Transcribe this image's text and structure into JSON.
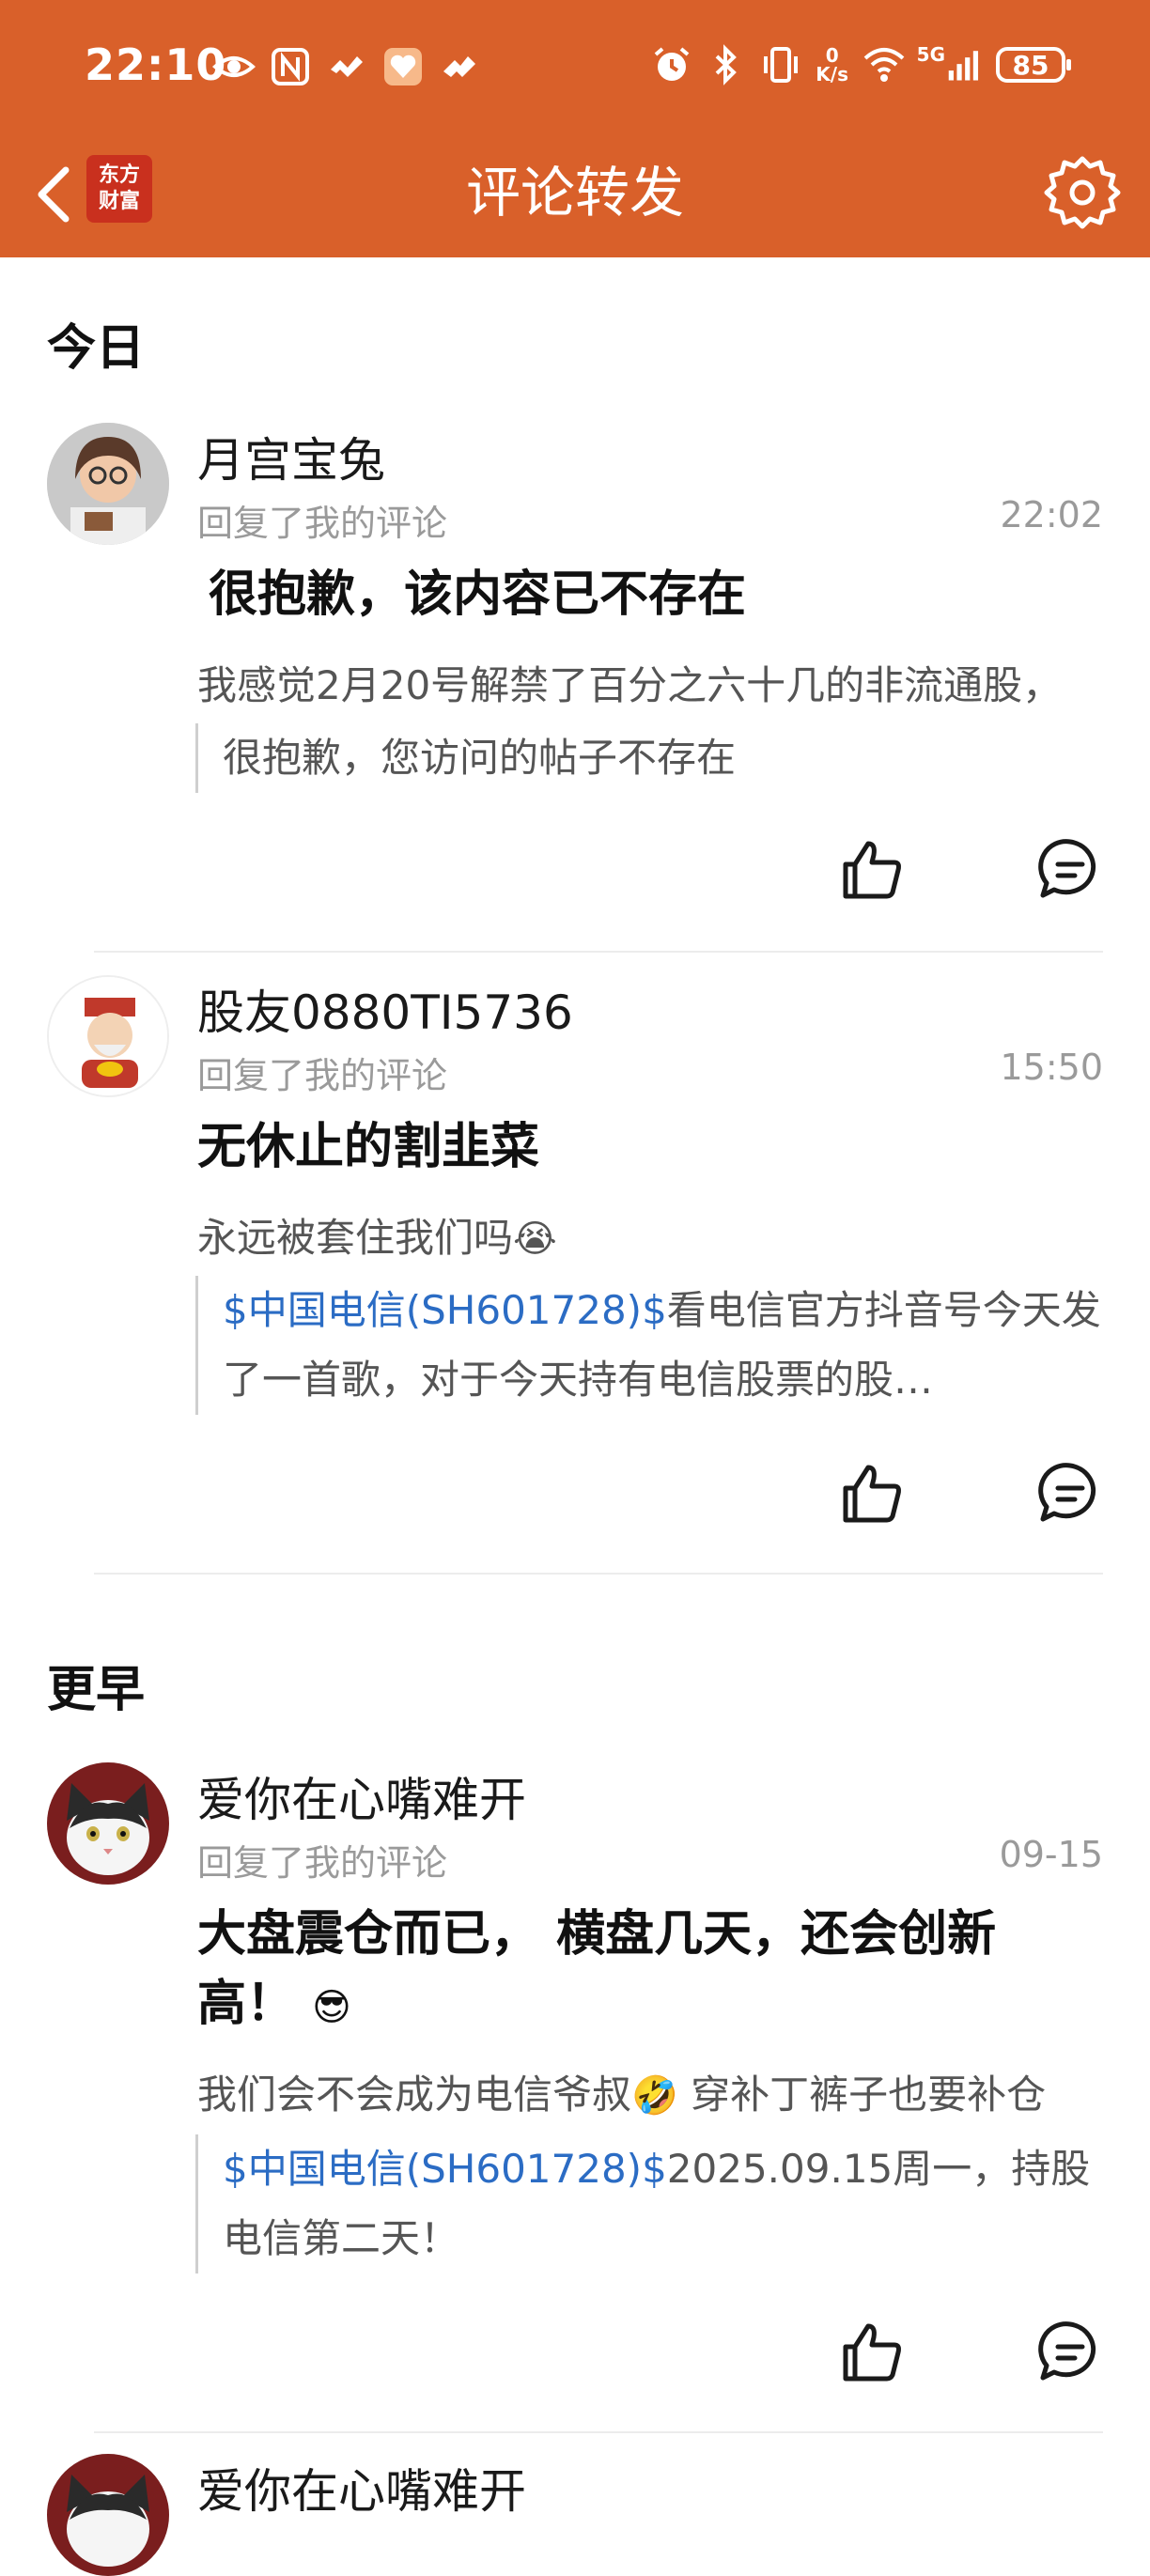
{
  "status_bar": {
    "time": "22:10",
    "net_speed_top": "0",
    "net_speed_unit": "K/s",
    "network": "5G",
    "battery": "85",
    "icons_left": [
      "eye-icon",
      "nfc-icon",
      "app-icon",
      "heart-badge-icon",
      "app-icon-2"
    ],
    "icons_right": [
      "alarm-icon",
      "bluetooth-icon",
      "vibrate-icon",
      "wifi-icon",
      "signal-icon"
    ]
  },
  "nav": {
    "brand_line1": "东方",
    "brand_line2": "财富",
    "title": "评论转发"
  },
  "sections": {
    "today": "今日",
    "earlier": "更早"
  },
  "items": [
    {
      "username": "月宫宝兔",
      "action": "回复了我的评论",
      "time": "22:02",
      "comment": "很抱歉，该内容已不存在",
      "reply": "我感觉2月20号解禁了百分之六十几的非流通股，",
      "quote_link": "",
      "quote_text": "很抱歉，您访问的帖子不存在"
    },
    {
      "username": "股友0880TI5736",
      "action": "回复了我的评论",
      "time": "15:50",
      "comment": "无休止的割韭菜",
      "reply": "永远被套住我们吗",
      "reply_emoji": "😭",
      "quote_link": "$中国电信(SH601728)$",
      "quote_text": "看电信官方抖音号今天发了一首歌，对于今天持有电信股票的股…"
    },
    {
      "username": "爱你在心嘴难开",
      "action": "回复了我的评论",
      "time": "09-15",
      "comment": "大盘震仓而已， 横盘几天，还会创新高！",
      "comment_emoji": "😎",
      "reply": "我们会不会成为电信爷叔",
      "reply_emoji": "🤣",
      "reply_tail": "  穿补丁裤子也要补仓",
      "quote_link": "$中国电信(SH601728)$",
      "quote_text": "2025.09.15周一，持股电信第二天！"
    },
    {
      "username": "爱你在心嘴难开"
    }
  ],
  "colors": {
    "header": "#d9602a",
    "link": "#2b6cc4",
    "muted": "#9a9a9a"
  }
}
